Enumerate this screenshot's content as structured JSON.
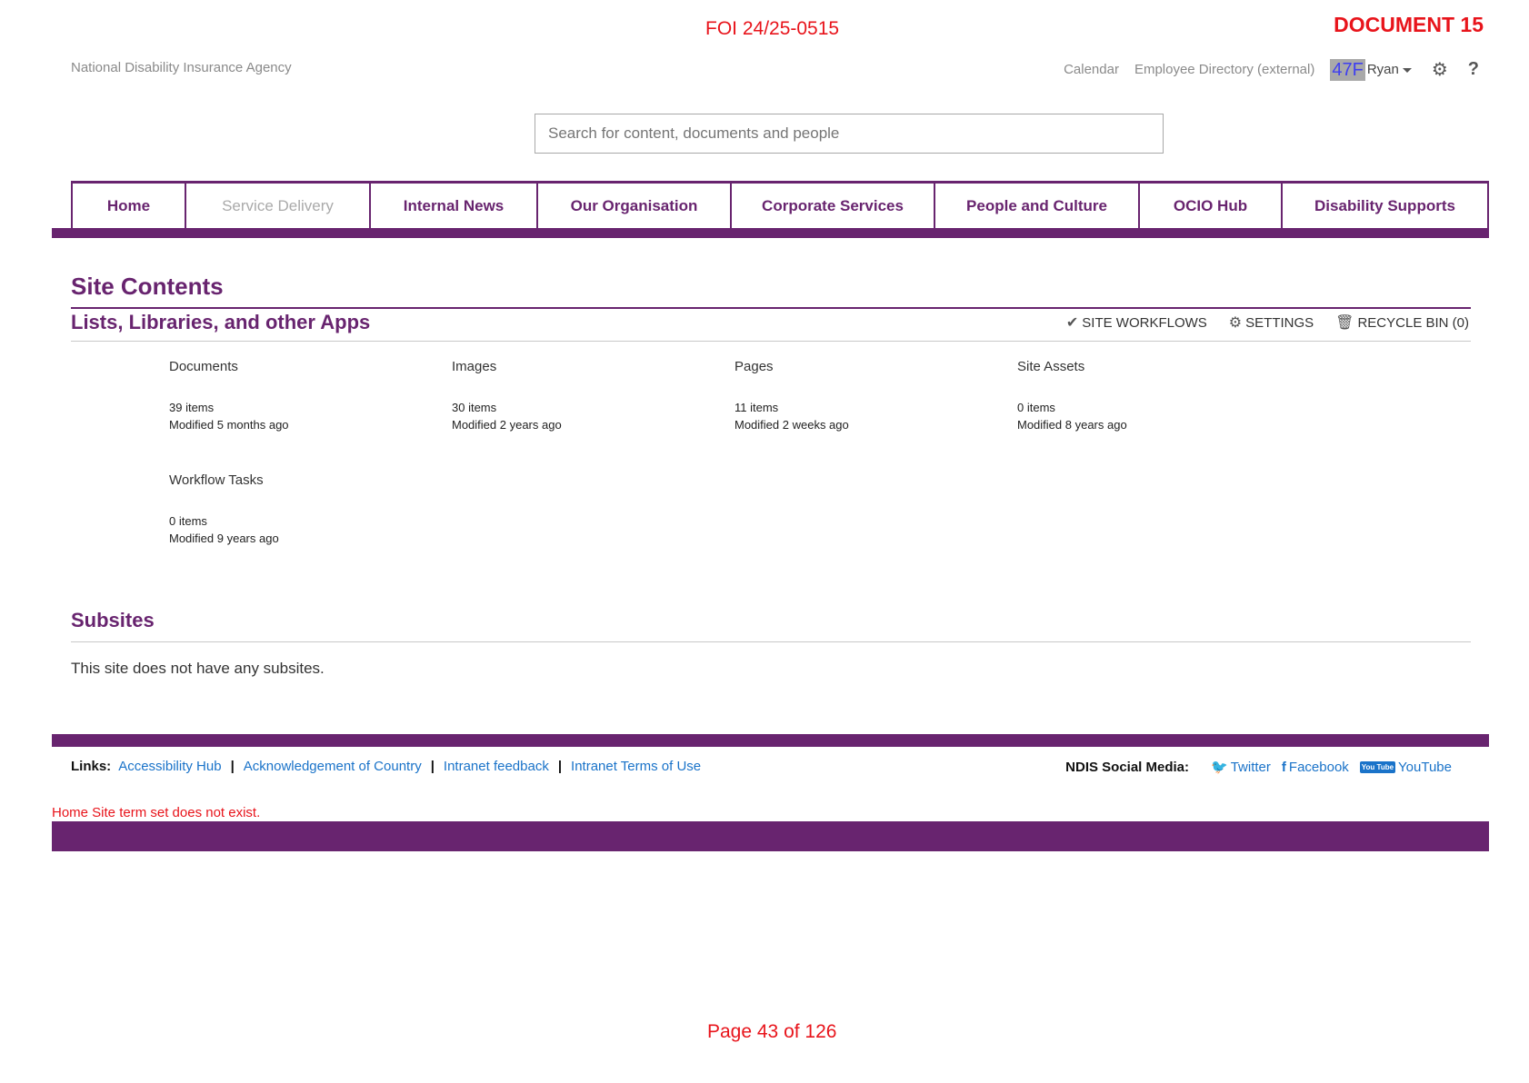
{
  "stamp": {
    "foi_ref": "FOI 24/25-0515",
    "document_label": "DOCUMENT 15",
    "page": "Page 43 of 126"
  },
  "header": {
    "agency": "National Disability Insurance Agency",
    "links": [
      "Calendar",
      "Employee Directory (external)"
    ],
    "redacted": "47F",
    "user": "Ryan",
    "icons": [
      "gear-icon",
      "help-icon"
    ]
  },
  "search": {
    "placeholder": "Search for content, documents and people"
  },
  "nav": {
    "tabs": [
      {
        "label": "Home",
        "state": "selected"
      },
      {
        "label": "Service Delivery",
        "state": "disabled"
      },
      {
        "label": "Internal News",
        "state": "normal"
      },
      {
        "label": "Our Organisation",
        "state": "normal"
      },
      {
        "label": "Corporate Services",
        "state": "normal"
      },
      {
        "label": "People and Culture",
        "state": "normal"
      },
      {
        "label": "OCIO Hub",
        "state": "normal"
      },
      {
        "label": "Disability Supports",
        "state": "normal"
      }
    ],
    "accent": "#68246f"
  },
  "main": {
    "title": "Site Contents",
    "section_title": "Lists, Libraries, and other Apps",
    "actions": {
      "workflows": "SITE WORKFLOWS",
      "settings": "SETTINGS",
      "recycle": "RECYCLE BIN (0)"
    },
    "tiles": [
      {
        "name": "Documents",
        "count": "39 items",
        "modified": "Modified 5 months ago"
      },
      {
        "name": "Images",
        "count": "30 items",
        "modified": "Modified 2 years ago"
      },
      {
        "name": "Pages",
        "count": "11 items",
        "modified": "Modified 2 weeks ago"
      },
      {
        "name": "Site Assets",
        "count": "0 items",
        "modified": "Modified 8 years ago"
      },
      {
        "name": "Workflow Tasks",
        "count": "0 items",
        "modified": "Modified 9 years ago"
      }
    ],
    "subsites_title": "Subsites",
    "subsites_text": "This site does not have any subsites."
  },
  "footer": {
    "links_label": "Links:",
    "links": [
      "Accessibility Hub",
      "Acknowledgement of Country",
      "Intranet feedback",
      "Intranet Terms of Use"
    ],
    "social_label": "NDIS Social Media:",
    "social": {
      "twitter": "Twitter",
      "facebook": "Facebook",
      "youtube": "YouTube",
      "youtube_badge": "You Tube"
    },
    "error": "Home Site term set does not exist."
  }
}
